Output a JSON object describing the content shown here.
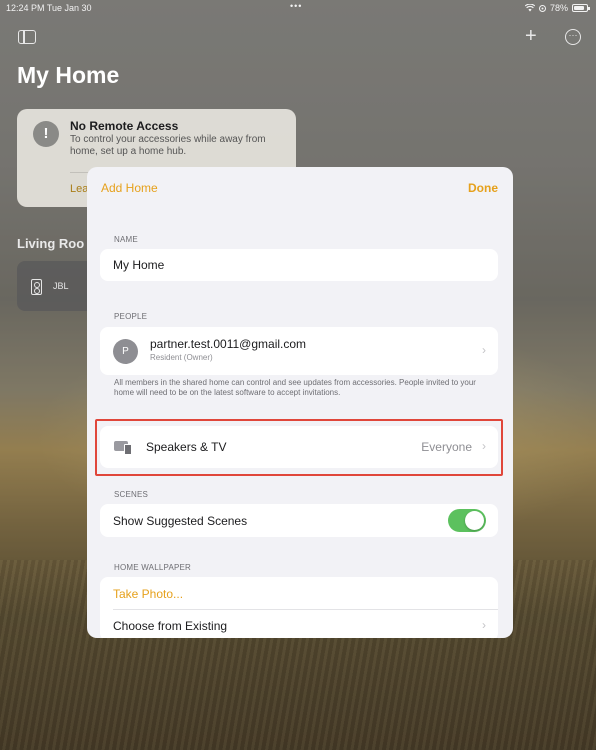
{
  "status_bar": {
    "time": "12:24 PM  Tue Jan 30",
    "dots": "•••",
    "wifi": "wifi-icon",
    "battery_percent": "78%"
  },
  "toolbar": {
    "sidebar_icon": "sidebar-icon",
    "add": "+",
    "more": "···"
  },
  "home": {
    "title": "My Home"
  },
  "remote_access": {
    "icon": "!",
    "title": "No Remote Access",
    "body": "To control your accessories while away from home, set up a home hub.",
    "link": "Lea"
  },
  "rooms": {
    "label": "Living Roo",
    "tile_label": "JBL"
  },
  "sheet": {
    "title": "Add Home",
    "done": "Done",
    "name_section": "NAME",
    "name_value": "My Home",
    "people_section": "PEOPLE",
    "person": {
      "initial": "P",
      "email": "partner.test.0011@gmail.com",
      "role": "Resident (Owner)"
    },
    "people_footnote": "All members in the shared home can control and see updates from accessories. People invited to your home will need to be on the latest software to accept invitations.",
    "speakers": {
      "label": "Speakers & TV",
      "value": "Everyone"
    },
    "scenes_section": "SCENES",
    "suggested_scenes": {
      "label": "Show Suggested Scenes",
      "enabled": true
    },
    "wallpaper_section": "HOME WALLPAPER",
    "take_photo": "Take Photo...",
    "choose_existing": "Choose from Existing"
  },
  "colors": {
    "accent": "#e6a11c",
    "toggle_on": "#5cc15e",
    "highlight": "#e0463a"
  }
}
